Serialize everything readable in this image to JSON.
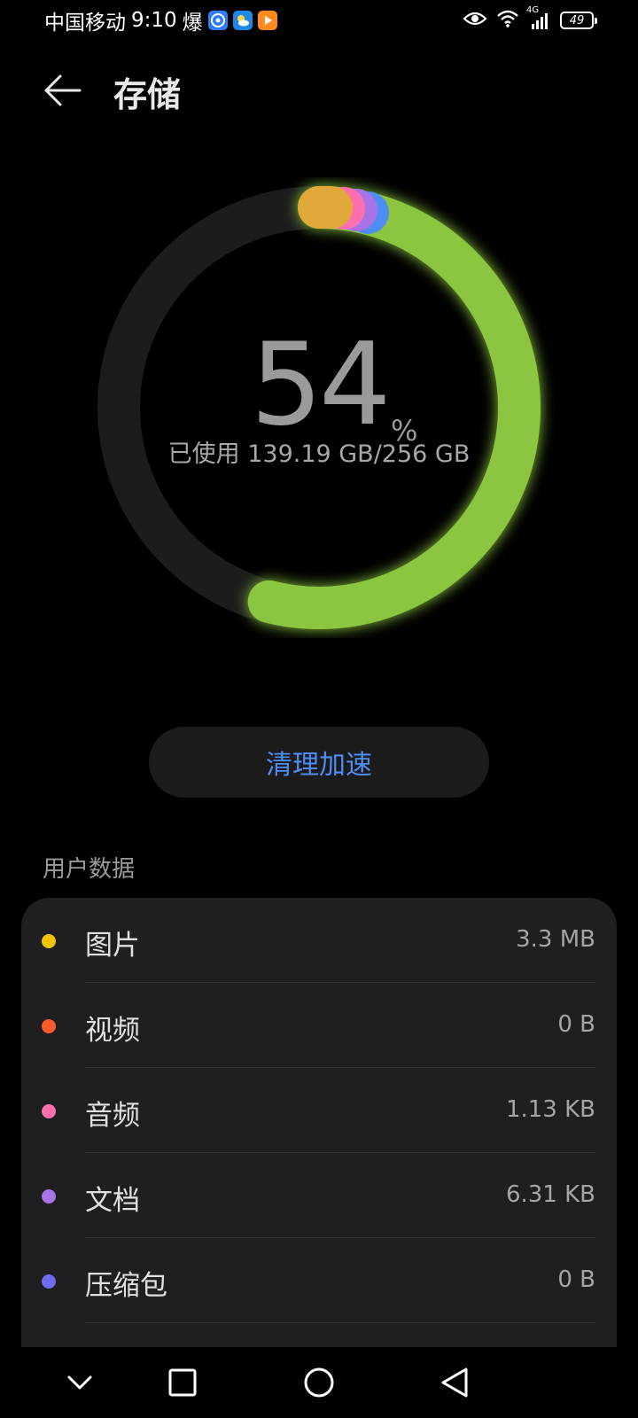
{
  "status_bar": {
    "carrier": "中国移动",
    "time": "9:10",
    "extra_glyph": "爆",
    "network": "4G",
    "battery": "49"
  },
  "header": {
    "title": "存储"
  },
  "storage": {
    "percent": "54",
    "percent_sign": "%",
    "used_text": "已使用 139.19 GB/256 GB",
    "used_fraction": 0.54
  },
  "colors": {
    "ring_track": "#1c1c1c",
    "apps_green": "#8cc63f",
    "images": "#f5c400",
    "videos": "#ff5a2b",
    "audio": "#ff6fae",
    "docs": "#a873e6",
    "archives": "#6f6cf0",
    "accent_blue": "#4f8df5"
  },
  "clean_button": {
    "label": "清理加速"
  },
  "user_data": {
    "section_title": "用户数据",
    "items": [
      {
        "label": "图片",
        "value": "3.3 MB",
        "color": "#f5c400"
      },
      {
        "label": "视频",
        "value": "0 B",
        "color": "#ff5a2b"
      },
      {
        "label": "音频",
        "value": "1.13 KB",
        "color": "#ff6fae"
      },
      {
        "label": "文档",
        "value": "6.31 KB",
        "color": "#a873e6"
      },
      {
        "label": "压缩包",
        "value": "0 B",
        "color": "#6f6cf0"
      }
    ]
  },
  "nav_bar": {
    "icons": [
      "chevron-down-icon",
      "square-icon",
      "circle-icon",
      "triangle-back-icon"
    ]
  }
}
